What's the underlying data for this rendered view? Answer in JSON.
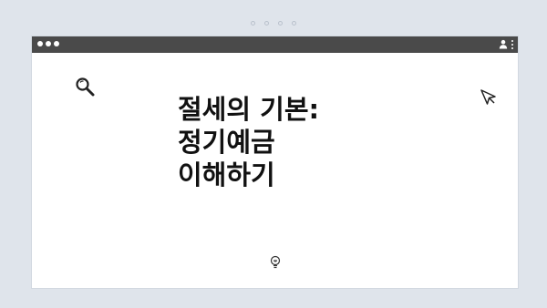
{
  "top_indicators": [
    "dot",
    "dot",
    "dot",
    "dot"
  ],
  "window": {
    "controls": [
      "close",
      "minimize",
      "maximize"
    ],
    "toolbar_icons": [
      "user-icon",
      "more-vertical-icon"
    ]
  },
  "content": {
    "title_lines": [
      "절세의 기본:",
      "정기예금",
      "이해하기"
    ],
    "decor_icons": [
      "search-icon",
      "cursor-pointer-icon",
      "lightbulb-icon"
    ]
  }
}
